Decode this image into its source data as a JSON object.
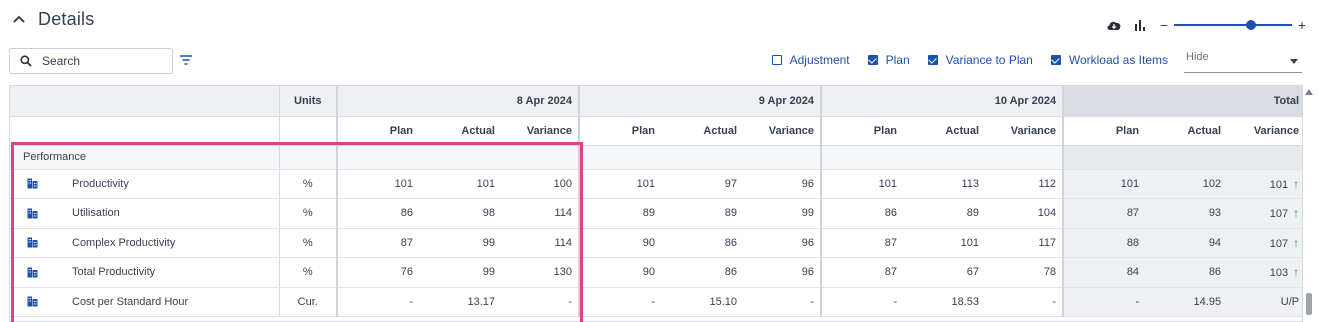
{
  "header": {
    "title": "Details",
    "collapse_icon": "chevron-up-icon"
  },
  "toolbar": {
    "search_placeholder": "Search",
    "options": [
      {
        "label": "Adjustment",
        "checked": false
      },
      {
        "label": "Plan",
        "checked": true
      },
      {
        "label": "Variance to Plan",
        "checked": true
      },
      {
        "label": "Workload as Items",
        "checked": true
      }
    ],
    "hide_select": {
      "label": "Hide"
    },
    "zoom_level": 0.62
  },
  "table": {
    "units_header": "Units",
    "dates": [
      "8 Apr 2024",
      "9 Apr 2024",
      "10 Apr 2024"
    ],
    "total_header": "Total",
    "subheaders": [
      "Plan",
      "Actual",
      "Variance"
    ],
    "group": "Performance",
    "rows": [
      {
        "name": "Productivity",
        "unit": "%",
        "d1": [
          "101",
          "101",
          "100"
        ],
        "d2": [
          "101",
          "97",
          "96"
        ],
        "d3": [
          "101",
          "113",
          "112"
        ],
        "total": [
          "101",
          "102",
          "101"
        ],
        "up": true
      },
      {
        "name": "Utilisation",
        "unit": "%",
        "d1": [
          "86",
          "98",
          "114"
        ],
        "d2": [
          "89",
          "89",
          "99"
        ],
        "d3": [
          "86",
          "89",
          "104"
        ],
        "total": [
          "87",
          "93",
          "107"
        ],
        "up": true
      },
      {
        "name": "Complex Productivity",
        "unit": "%",
        "d1": [
          "87",
          "99",
          "114"
        ],
        "d2": [
          "90",
          "86",
          "96"
        ],
        "d3": [
          "87",
          "101",
          "117"
        ],
        "total": [
          "88",
          "94",
          "107"
        ],
        "up": true
      },
      {
        "name": "Total Productivity",
        "unit": "%",
        "d1": [
          "76",
          "99",
          "130"
        ],
        "d2": [
          "90",
          "86",
          "96"
        ],
        "d3": [
          "87",
          "67",
          "78"
        ],
        "total": [
          "84",
          "86",
          "103"
        ],
        "up": true
      },
      {
        "name": "Cost per Standard Hour",
        "unit": "Cur.",
        "d1": [
          "-",
          "13.17",
          "-"
        ],
        "d2": [
          "-",
          "15.10",
          "-"
        ],
        "d3": [
          "-",
          "18.53",
          "-"
        ],
        "total": [
          "-",
          "14.95",
          "U/P"
        ],
        "up": false
      }
    ],
    "up_arrow_glyph": "↑",
    "colors": {
      "accent": "#1e50b3",
      "up": "#1aa34a",
      "highlight": "#e0428a"
    }
  }
}
